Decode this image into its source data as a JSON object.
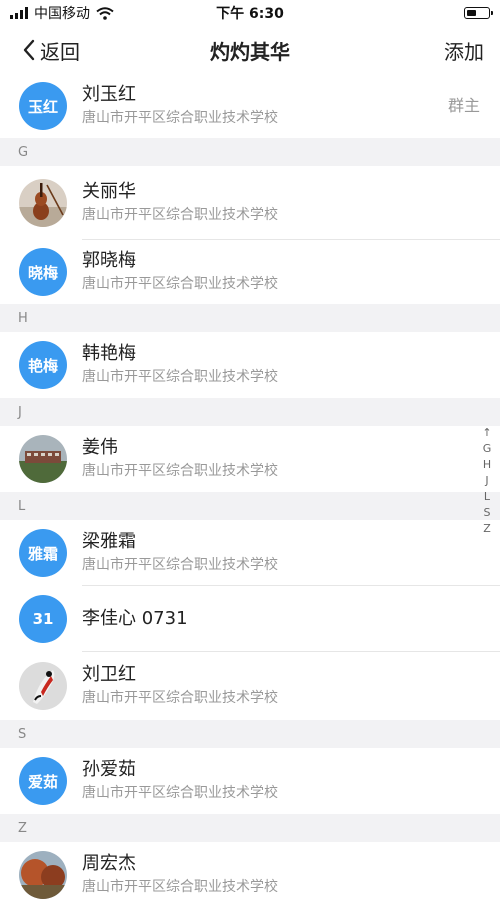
{
  "status_bar": {
    "carrier": "中国移动",
    "time": "下午 6:30",
    "battery_level": 0.45
  },
  "nav": {
    "back_label": "返回",
    "title": "灼灼其华",
    "action_label": "添加"
  },
  "top_member": {
    "avatar_text": "玉红",
    "name": "刘玉红",
    "school": "唐山市开平区综合职业技术学校",
    "tag": "群主"
  },
  "sections": [
    {
      "letter": "G",
      "members": [
        {
          "name": "关丽华",
          "school": "唐山市开平区综合职业技术学校"
        },
        {
          "avatar_text": "晓梅",
          "name": "郭晓梅",
          "school": "唐山市开平区综合职业技术学校"
        }
      ]
    },
    {
      "letter": "H",
      "members": [
        {
          "avatar_text": "艳梅",
          "name": "韩艳梅",
          "school": "唐山市开平区综合职业技术学校"
        }
      ]
    },
    {
      "letter": "J",
      "members": [
        {
          "name": "姜伟",
          "school": "唐山市开平区综合职业技术学校"
        }
      ]
    },
    {
      "letter": "L",
      "members": [
        {
          "avatar_text": "雅霜",
          "name": "梁雅霜",
          "school": "唐山市开平区综合职业技术学校"
        },
        {
          "avatar_text": "31",
          "name": "李佳心 0731"
        },
        {
          "name": "刘卫红",
          "school": "唐山市开平区综合职业技术学校"
        }
      ]
    },
    {
      "letter": "S",
      "members": [
        {
          "avatar_text": "爱茹",
          "name": "孙爱茹",
          "school": "唐山市开平区综合职业技术学校"
        }
      ]
    },
    {
      "letter": "Z",
      "members": [
        {
          "name": "周宏杰",
          "school": "唐山市开平区综合职业技术学校"
        }
      ]
    }
  ],
  "index_bar": [
    "↑",
    "G",
    "H",
    "J",
    "L",
    "S",
    "Z"
  ],
  "colors": {
    "avatar_blue": "#3a9af0",
    "section_bg": "#f2f2f4"
  }
}
